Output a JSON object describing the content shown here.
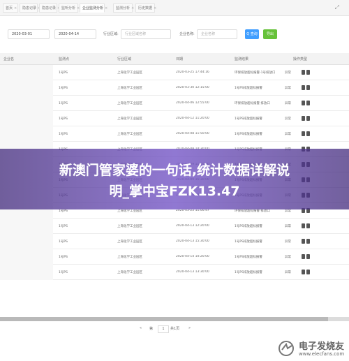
{
  "tabs": [
    {
      "label": "首页",
      "active": false
    },
    {
      "label": "隐患记录",
      "active": false
    },
    {
      "label": "隐患记录",
      "active": false
    },
    {
      "label": "监听分析",
      "active": false
    },
    {
      "label": "企业监测分析",
      "active": true
    },
    {
      "label": "监测分析",
      "active": false
    },
    {
      "label": "历史数据",
      "active": false
    }
  ],
  "filters": {
    "start_date": "2020-03-01",
    "end_date": "2020-04-14",
    "industry_label": "行业区域:",
    "industry_placeholder": "行业区域名称",
    "company_label": "企业名称:",
    "company_placeholder": "企业名称",
    "search_button": "Q 查询",
    "export_button": "导出"
  },
  "table": {
    "columns": [
      "企业名",
      "监测点",
      "行业区域",
      "日期",
      "监测结果",
      "操作类型"
    ],
    "rows": [
      {
        "point": "1号PS",
        "area": "上海化学工业园区",
        "time": "2020-03-25 17:44:16",
        "result": "环保排放超标报警-1号排放口",
        "status": "异常"
      },
      {
        "point": "1号PS",
        "area": "上海化学工业园区",
        "time": "2020-03-30 12:15:00",
        "result": "1号PS排放超标报警",
        "status": "异常"
      },
      {
        "point": "1号PS",
        "area": "上海化学工业园区",
        "time": "2020-04-06 12:55:00",
        "result": "环保排放超标报警 排放口",
        "status": "异常"
      },
      {
        "point": "1号PS",
        "area": "上海化学工业园区",
        "time": "2020-04-12 11:20:00",
        "result": "1号PS排放超标报警",
        "status": "异常"
      },
      {
        "point": "1号PS",
        "area": "上海化学工业园区",
        "time": "2020-04-08 11:50:00",
        "result": "1号PS排放超标报警",
        "status": "异常"
      },
      {
        "point": "1号PS",
        "area": "上海化学工业园区",
        "time": "2020-04-08 14:30:00",
        "result": "1号PS排放超标报警",
        "status": "异常"
      },
      {
        "point": "1号PS",
        "area": "上海化学工业园区",
        "time": "2020-04-09 11:10:00",
        "result": "1号PS排放超标报警",
        "status": "异常"
      },
      {
        "point": "1号PS",
        "area": "上海化学工业园区",
        "time": "2020-04-09 16:30:00",
        "result": "1号PS排放超标报警",
        "status": "异常"
      },
      {
        "point": "1号PS",
        "area": "上海化学工业园区",
        "time": "2020-04-10 09:30:00",
        "result": "1号PS排放超标报警",
        "status": "异常"
      },
      {
        "point": "1号PS",
        "area": "上海化学工业园区",
        "time": "2020-03-25 11:00:47",
        "result": "环保排放超标报警 排放口",
        "status": "异常"
      },
      {
        "point": "1号PS",
        "area": "上海化学工业园区",
        "time": "2020-04-13 12:20:00",
        "result": "1号PS排放超标报警",
        "status": "异常"
      },
      {
        "point": "1号PS",
        "area": "上海化学工业园区",
        "time": "2020-04-13 15:30:00",
        "result": "1号PS排放超标报警",
        "status": "异常"
      },
      {
        "point": "1号PS",
        "area": "上海化学工业园区",
        "time": "2020-04-14 10:20:00",
        "result": "1号PS排放超标报警",
        "status": "异常"
      },
      {
        "point": "1号PS",
        "area": "上海化学工业园区",
        "time": "2020-04-13 13:30:00",
        "result": "1号PS排放超标报警",
        "status": "异常"
      }
    ]
  },
  "pagination": {
    "prev": "«",
    "page_prefix": "第",
    "page": "1",
    "page_suffix": "共1页",
    "next": "»"
  },
  "banner": {
    "line1": "新澳门管家婆的一句话,统计数据详解说",
    "line2": "明_掌中宝FZK13.47"
  },
  "watermark": {
    "title": "电子发烧友",
    "url": "www.elecfans.com"
  },
  "colors": {
    "search_button": "#409eff",
    "export_button": "#67c23a",
    "banner": "#6a4fb0"
  }
}
